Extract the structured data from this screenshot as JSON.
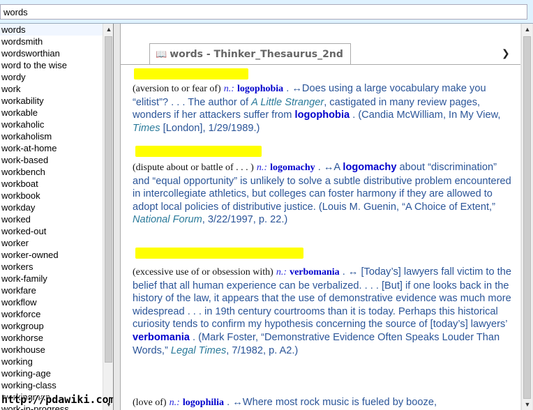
{
  "search": {
    "value": "words"
  },
  "word_list": {
    "items": [
      "words",
      "wordsmith",
      "wordsworthian",
      "word to the wise",
      "wordy",
      "work",
      "workability",
      "workable",
      "workaholic",
      "workaholism",
      "work-at-home",
      "work-based",
      "workbench",
      "workboat",
      "workbook",
      "workday",
      "worked",
      "worked-out",
      "worker",
      "worker-owned",
      "workers",
      "work-family",
      "workfare",
      "workflow",
      "workforce",
      "workgroup",
      "workhorse",
      "workhouse",
      "working",
      "working-age",
      "working-class",
      "workingman",
      "work-in-progress"
    ]
  },
  "watermark": "http://pdawiki.com",
  "tab": {
    "icon": "book-icon",
    "label": "words - Thinker_Thesaurus_2nd"
  },
  "entries": [
    {
      "gloss": "(aversion to or fear of)",
      "pos": "n.:",
      "term": "logophobia",
      "arrow": ". ↔",
      "t1": "Does using a large vocabulary make you “elitist”? . . . The author of ",
      "i1": "A Little Stranger",
      "t2": ", castigated in many review pages, wonders if her attackers suffer from ",
      "hw": "logophobia",
      "t3": " . (Candia McWilliam, In My View, ",
      "i2": "Times",
      "t4": " [London], 1/29/1989.)"
    },
    {
      "gloss": "(dispute about or battle of . . . )",
      "pos": "n.:",
      "term": "logomachy",
      "arrow": ". ↔",
      "t1": "A ",
      "hw": "logomachy",
      "t2": " about “discrimination” and “equal opportunity” is unlikely to solve a subtle distributive problem encountered in intercollegiate athletics, but colleges can foster harmony if they are allowed to adopt local policies of distributive justice. (Louis M. Guenin, “A Choice of Extent,” ",
      "i1": "National Forum",
      "t3": ", 3/22/1997, p. 22.)"
    },
    {
      "gloss": "(excessive use of or obsession with)",
      "pos": "n.:",
      "term": "verbomania",
      "arrow": ". ↔",
      "t1": " [Today’s] lawyers fall victim to the belief that all human experience can be verbalized. . . . [But] if one looks back in the history of the law, it appears that the use of demonstrative evidence was much more widespread . . . in 19th century courtrooms than it is today. Perhaps this historical curiosity tends to confirm my hypothesis concerning the source of [today’s] lawyers’ ",
      "hw": "verbomania",
      "t2": " . (Mark Foster, “Demonstrative Evidence Often Speaks Louder Than Words,” ",
      "i1": "Legal Times",
      "t3": ", 7/1982, p. A2.)"
    },
    {
      "gloss": "(love of)",
      "pos": "n.:",
      "term": "logophilia",
      "arrow": ". ↔",
      "t1": "Where most rock music is fueled by booze,"
    }
  ],
  "colors": {
    "highlight": "#ffff00",
    "example_text": "#2b5598",
    "headword": "#0000cc",
    "source_italic": "#2a7a9a",
    "search_bar_bg": "#dff2ff"
  }
}
